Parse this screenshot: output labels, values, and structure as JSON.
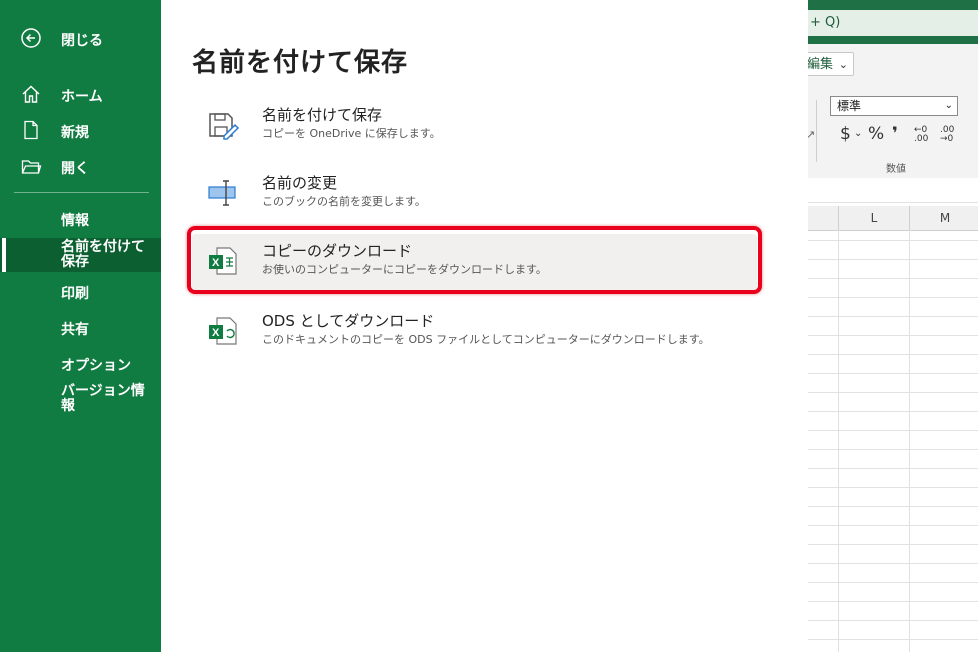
{
  "nav": {
    "items": [
      {
        "label": "閉じる",
        "icon": "back-arrow-icon"
      },
      {
        "label": "ホーム",
        "icon": "home-icon"
      },
      {
        "label": "新規",
        "icon": "new-document-icon"
      },
      {
        "label": "開く",
        "icon": "open-folder-icon"
      },
      {
        "label": "情報"
      },
      {
        "label": "名前を付けて保存",
        "selected": true
      },
      {
        "label": "印刷"
      },
      {
        "label": "共有"
      },
      {
        "label": "オプション"
      },
      {
        "label": "バージョン情報"
      }
    ]
  },
  "main": {
    "title": "名前を付けて保存",
    "options": [
      {
        "title": "名前を付けて保存",
        "desc": "コピーを OneDrive に保存します。",
        "icon": "save-as-icon"
      },
      {
        "title": "名前の変更",
        "desc": "このブックの名前を変更します。",
        "icon": "rename-icon"
      },
      {
        "title": "コピーのダウンロード",
        "desc": "お使いのコンピューターにコピーをダウンロードします。",
        "icon": "excel-download-icon",
        "highlighted": true
      },
      {
        "title": "ODS としてダウンロード",
        "desc": "このドキュメントのコピーを ODS ファイルとしてコンピューターにダウンロードします。",
        "icon": "excel-ods-icon"
      }
    ]
  },
  "excel_bg": {
    "search_text": "+ Q)",
    "edit_label": "編集",
    "number_format": "標準",
    "number_tools": [
      "$",
      "%",
      "❜",
      "←0 .00",
      ".00 →0"
    ],
    "number_group_label": "数値",
    "columns": [
      "L",
      "M"
    ]
  },
  "colors": {
    "nav_green": "#107c41",
    "nav_selected": "#0b5f31",
    "highlight_red": "#e8001c"
  }
}
